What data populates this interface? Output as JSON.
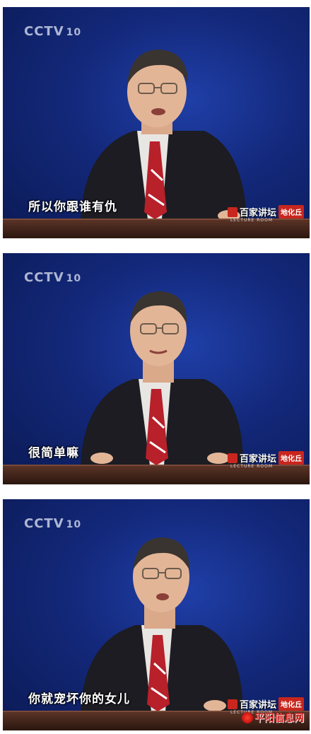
{
  "channel_logo": {
    "text": "CCTV",
    "number": "10"
  },
  "show": {
    "name": "百家讲坛",
    "stamp": "地化丘",
    "tagline": "LECTURE ROOM"
  },
  "frames": [
    {
      "subtitle": "所以你跟谁有仇"
    },
    {
      "subtitle": "很简单嘛"
    },
    {
      "subtitle": "你就宠坏你的女儿"
    }
  ],
  "watermark": {
    "text": "平阳信息网"
  },
  "colors": {
    "background": "#13287a",
    "tie": "#b8202a",
    "suit": "#1c1c22",
    "desk": "#4a2a1e"
  }
}
